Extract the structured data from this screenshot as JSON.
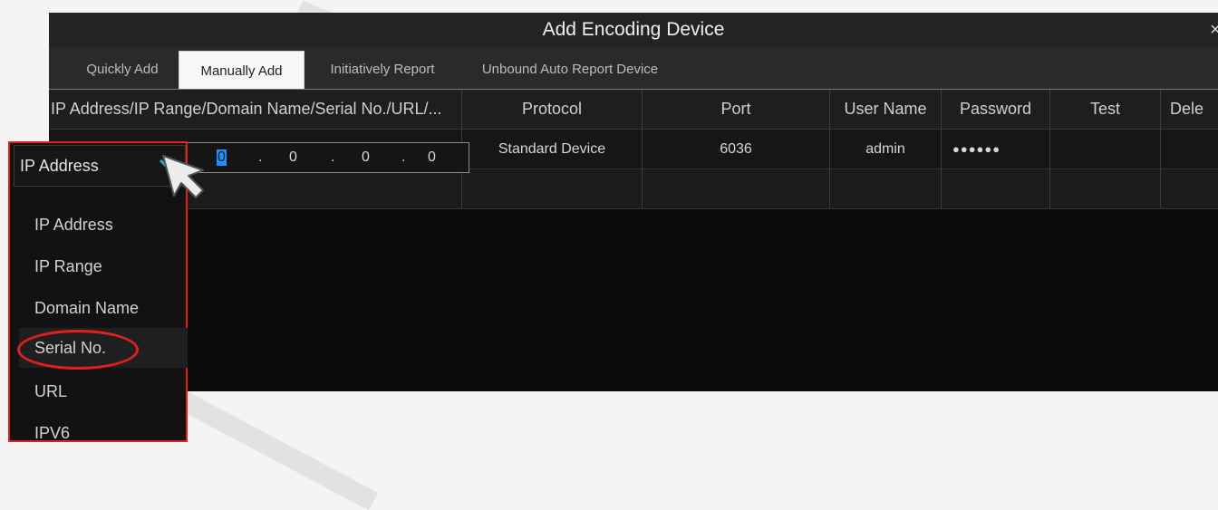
{
  "dialog": {
    "title": "Add  Encoding Device",
    "close_glyph": "×"
  },
  "tabs": [
    {
      "label": "Quickly Add",
      "active": false
    },
    {
      "label": "Manually Add",
      "active": true
    },
    {
      "label": "Initiatively Report",
      "active": false
    },
    {
      "label": "Unbound Auto Report Device",
      "active": false
    }
  ],
  "table": {
    "columns": [
      "IP Address/IP Range/Domain Name/Serial No./URL/...",
      "Protocol",
      "Port",
      "User Name",
      "Password",
      "Test",
      "Dele"
    ],
    "row": {
      "ip_octets": [
        "0",
        "0",
        "0",
        "0"
      ],
      "ip_separator": ".",
      "protocol": "Standard Device",
      "port": "6036",
      "user_name": "admin",
      "password": "●●●●●●",
      "test": ""
    }
  },
  "dropdown": {
    "selected": "IP Address",
    "options": [
      "IP Address",
      "IP Range",
      "Domain Name",
      "Serial No.",
      "URL",
      "IPV6"
    ],
    "highlighted": "Serial No."
  },
  "colors": {
    "accent": "#1e90ff",
    "annotation": "#e02020",
    "chevron": "#2aa9d8"
  }
}
